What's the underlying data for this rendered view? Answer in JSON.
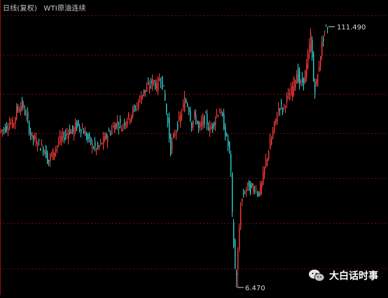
{
  "header": {
    "period": "日线(复权)",
    "instrument": "WTI原油连续"
  },
  "watermark": {
    "text": "大白话时事",
    "icon": "wechat-icon"
  },
  "colors": {
    "background": "#000000",
    "up": "#ff3b3b",
    "down": "#2fd3d3",
    "grid": "#6b0f0f",
    "left_axis": "#8a1010",
    "annotation": "#d8d8d8"
  },
  "chart_data": {
    "type": "candlestick",
    "grid": true,
    "annotations": [
      {
        "label": "111.490",
        "value": 111.49,
        "kind": "max"
      },
      {
        "label": "6.470",
        "value": 6.47,
        "kind": "min"
      }
    ],
    "series": [
      {
        "description": "approximate close path",
        "points": [
          [
            0,
            69
          ],
          [
            5,
            70
          ],
          [
            10,
            71
          ],
          [
            15,
            73
          ],
          [
            20,
            72
          ],
          [
            25,
            78
          ],
          [
            30,
            80
          ],
          [
            35,
            79
          ],
          [
            40,
            74
          ],
          [
            45,
            68
          ],
          [
            50,
            66
          ],
          [
            55,
            65
          ],
          [
            60,
            63
          ],
          [
            65,
            62
          ],
          [
            70,
            57
          ],
          [
            75,
            60
          ],
          [
            80,
            62
          ],
          [
            85,
            65
          ],
          [
            90,
            67
          ],
          [
            95,
            68
          ],
          [
            100,
            70
          ],
          [
            105,
            69
          ],
          [
            110,
            72
          ],
          [
            115,
            71
          ],
          [
            120,
            70
          ],
          [
            125,
            67
          ],
          [
            130,
            65
          ],
          [
            135,
            63
          ],
          [
            140,
            62
          ],
          [
            145,
            64
          ],
          [
            150,
            66
          ],
          [
            155,
            68
          ],
          [
            160,
            70
          ],
          [
            165,
            72
          ],
          [
            170,
            73
          ],
          [
            175,
            71
          ],
          [
            180,
            74
          ],
          [
            185,
            75
          ],
          [
            190,
            77
          ],
          [
            195,
            79
          ],
          [
            200,
            82
          ],
          [
            205,
            85
          ],
          [
            210,
            86
          ],
          [
            215,
            88
          ],
          [
            220,
            90
          ],
          [
            225,
            87
          ],
          [
            230,
            92
          ],
          [
            235,
            86
          ],
          [
            240,
            75
          ],
          [
            245,
            62
          ],
          [
            250,
            68
          ],
          [
            255,
            72
          ],
          [
            260,
            76
          ],
          [
            265,
            82
          ],
          [
            270,
            80
          ],
          [
            275,
            72
          ],
          [
            280,
            76
          ],
          [
            285,
            70
          ],
          [
            290,
            73
          ],
          [
            295,
            75
          ],
          [
            300,
            70
          ],
          [
            305,
            72
          ],
          [
            310,
            76
          ],
          [
            315,
            78
          ],
          [
            320,
            73
          ],
          [
            325,
            66
          ],
          [
            330,
            60
          ],
          [
            333,
            35
          ],
          [
            336,
            18
          ],
          [
            338,
            10
          ],
          [
            340,
            15
          ],
          [
            345,
            40
          ],
          [
            350,
            45
          ],
          [
            355,
            47
          ],
          [
            360,
            46
          ],
          [
            365,
            47
          ],
          [
            370,
            44
          ],
          [
            375,
            48
          ],
          [
            380,
            56
          ],
          [
            385,
            62
          ],
          [
            390,
            68
          ],
          [
            395,
            74
          ],
          [
            400,
            80
          ],
          [
            405,
            78
          ],
          [
            410,
            82
          ],
          [
            415,
            84
          ],
          [
            420,
            88
          ],
          [
            425,
            93
          ],
          [
            430,
            88
          ],
          [
            435,
            90
          ],
          [
            440,
            97
          ],
          [
            445,
            108
          ],
          [
            450,
            85
          ],
          [
            455,
            92
          ],
          [
            460,
            103
          ],
          [
            465,
            110
          ],
          [
            468,
            111.49
          ]
        ]
      }
    ],
    "max": 111.49,
    "min": 6.47
  }
}
